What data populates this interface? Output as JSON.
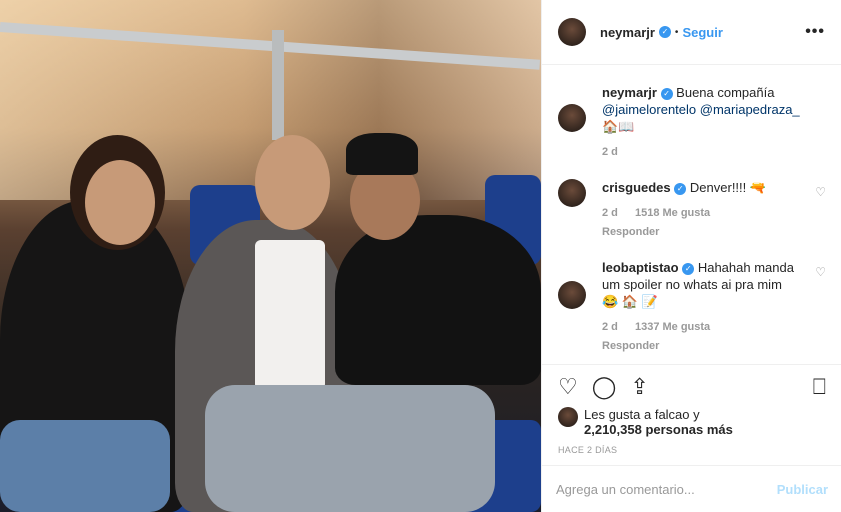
{
  "post": {
    "username": "neymarjr",
    "follow_label": "Seguir",
    "more_label": "•••"
  },
  "comments": [
    {
      "user": "neymarjr",
      "verified": true,
      "text": "Buena compañía",
      "mentions": "@jaimelorentelo @mariapedraza_",
      "emoji": "🏠📖",
      "age": "2 d"
    },
    {
      "user": "crisguedes",
      "verified": true,
      "text": "Denver!!!! 🔫",
      "age": "2 d",
      "likes": "1518 Me gusta",
      "reply": "Responder"
    },
    {
      "user": "leobaptistao",
      "verified": true,
      "text": "Hahahah manda um spoiler no whats ai pra mim",
      "emoji": "😂 🏠 📝",
      "age": "2 d",
      "likes": "1337 Me gusta",
      "reply": "Responder"
    }
  ],
  "likes": {
    "line1": "Les gusta a falcao y",
    "line2": "2,210,358 personas más",
    "time": "HACE 2 DÍAS"
  },
  "comment_box": {
    "placeholder": "Agrega un comentario...",
    "publish": "Publicar"
  },
  "icons": {
    "like": "heart-icon",
    "comment": "comment-icon",
    "share": "share-icon",
    "save": "bookmark-icon"
  }
}
